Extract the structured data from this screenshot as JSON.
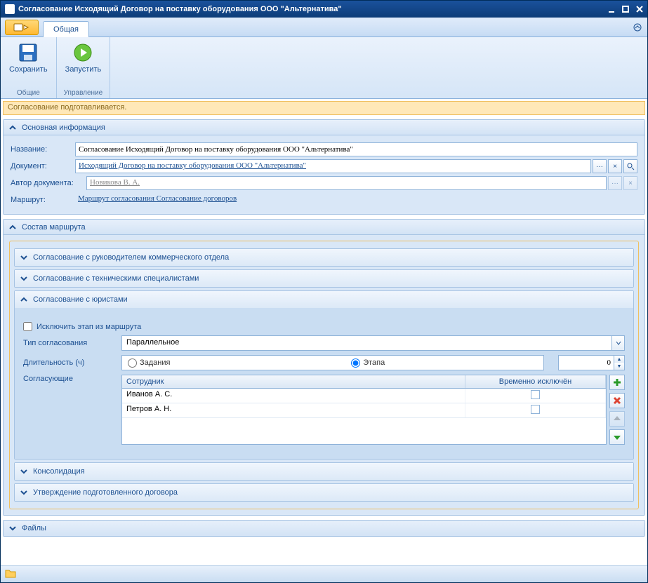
{
  "window": {
    "title": "Согласование Исходящий Договор на поставку оборудования ООО \"Альтернатива\""
  },
  "ribbon": {
    "tab": "Общая",
    "save": "Сохранить",
    "start": "Запустить",
    "group_common": "Общие",
    "group_manage": "Управление"
  },
  "status_msg": "Согласование подготавливается.",
  "info": {
    "header": "Основная информация",
    "name_lbl": "Название:",
    "name_val": "Согласование Исходящий Договор на поставку оборудования ООО \"Альтернатива\"",
    "doc_lbl": "Документ:",
    "doc_val": "Исходящий Договор на поставку оборудования ООО \"Альтернатива\"",
    "author_lbl": "Автор документа:",
    "author_val": "Новикова В. А.",
    "route_lbl": "Маршрут:",
    "route_val": "Маршрут согласования Согласование договоров"
  },
  "route": {
    "header": "Состав маршрута",
    "step1": "Согласование с руководителем коммерческого отдела",
    "step2": "Согласование с техническими специалистами",
    "step3": "Согласование с юристами",
    "step4": "Консолидация",
    "step5": "Утверждение подготовленного договора"
  },
  "detail": {
    "exclude": "Исключить этап из маршрута",
    "type_lbl": "Тип согласования",
    "type_val": "Параллельное",
    "dur_lbl": "Длительность (ч)",
    "dur_opt1": "Задания",
    "dur_opt2": "Этапа",
    "dur_val": "0",
    "approvers_lbl": "Согласующие",
    "col_emp": "Сотрудник",
    "col_ex": "Временно исключён",
    "rows": [
      {
        "emp": "Иванов А. С."
      },
      {
        "emp": "Петров А. Н."
      }
    ]
  },
  "files": {
    "header": "Файлы"
  }
}
